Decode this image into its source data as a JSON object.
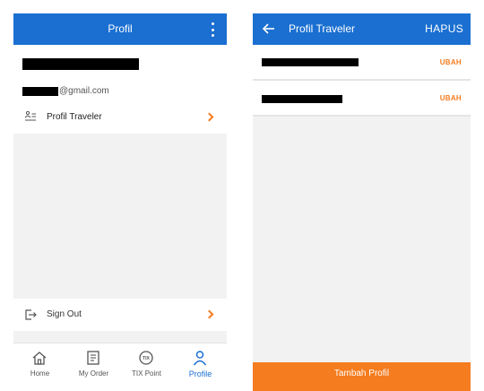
{
  "left_screen": {
    "header": {
      "title": "Profil"
    },
    "account": {
      "email_suffix": "@gmail.com"
    },
    "menu": {
      "traveler_label": "Profil Traveler",
      "signout_label": "Sign Out"
    },
    "bottom_nav": [
      {
        "label": "Home",
        "icon": "home-icon"
      },
      {
        "label": "My Order",
        "icon": "order-icon"
      },
      {
        "label": "TIX Point",
        "icon": "tix-point-icon"
      },
      {
        "label": "Profile",
        "icon": "profile-icon",
        "active": true
      }
    ]
  },
  "right_screen": {
    "header": {
      "title": "Profil Traveler",
      "action_label": "HAPUS"
    },
    "profiles": [
      {
        "action_label": "UBAH"
      },
      {
        "action_label": "UBAH"
      }
    ],
    "cta_label": "Tambah Profil"
  },
  "colors": {
    "primary_blue": "#1a6fd1",
    "accent_orange": "#f57c1f",
    "background_gray": "#f2f2f2"
  }
}
